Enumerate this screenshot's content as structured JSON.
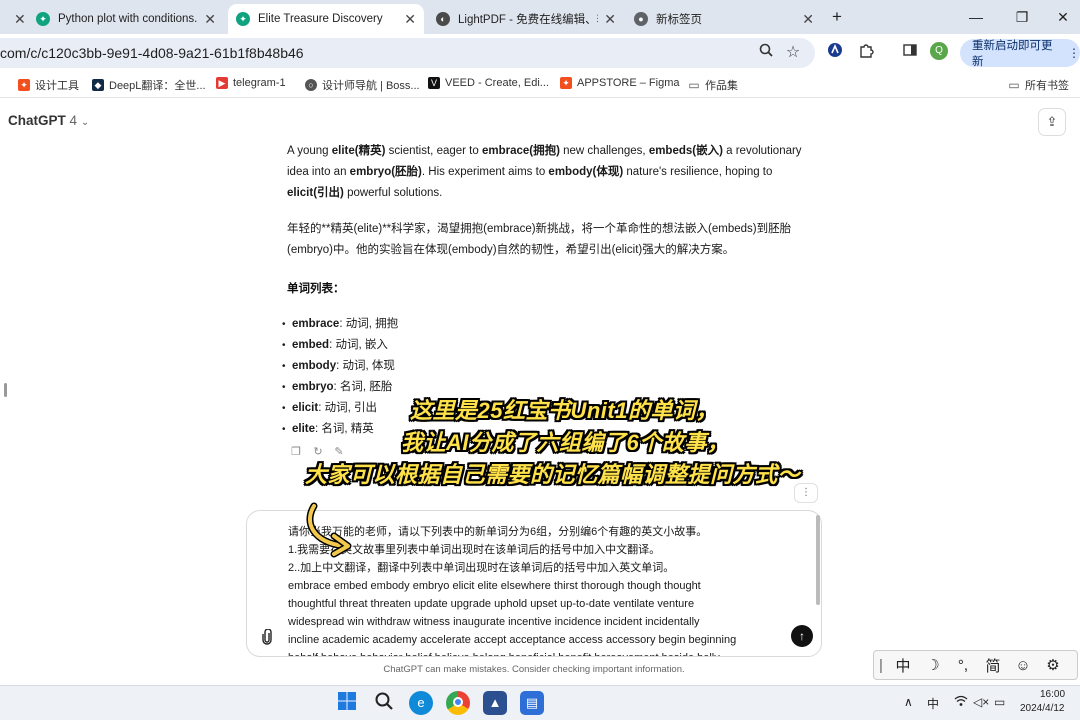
{
  "tabs": [
    {
      "title": "",
      "close": "✕"
    },
    {
      "title": "Python plot with conditions.",
      "close": "✕",
      "favicon_color": "#10a37f"
    },
    {
      "title": "Elite Treasure Discovery",
      "close": "✕",
      "favicon_color": "#10a37f",
      "active": true
    },
    {
      "title": "LightPDF - 免费在线编辑、转换",
      "close": "✕",
      "favicon_color": "#4a4a4a"
    },
    {
      "title": "新标签页",
      "close": "✕",
      "favicon_color": "#5f6368"
    }
  ],
  "new_tab": "+",
  "window_controls": {
    "minimize": "—",
    "maximize": "❐",
    "close": "✕"
  },
  "address": {
    "url": "com/c/c120c3bb-9e91-4d08-9a21-61b1f8b48b46",
    "update_button": "重新启动即可更新",
    "profile_initial": "Q"
  },
  "bookmarks": [
    {
      "label": "设计工具",
      "icon": "figma-icon",
      "color": "#f24e1e"
    },
    {
      "label": "DeepL翻译：全世...",
      "icon": "deepl-icon",
      "color": "#0f2b46"
    },
    {
      "label": "telegram-1",
      "icon": "telegram-icon",
      "color": "#e53935"
    },
    {
      "label": "设计师导航 | Boss...",
      "icon": "globe-icon",
      "color": "#555"
    },
    {
      "label": "VEED - Create, Edi...",
      "icon": "veed-icon",
      "color": "#111"
    },
    {
      "label": "APPSTORE – Figma",
      "icon": "figma-icon",
      "color": "#f24e1e"
    },
    {
      "label": "作品集",
      "icon": "folder-icon",
      "color": "#555"
    },
    {
      "label": "所有书签",
      "icon": "folder-icon",
      "color": "#555"
    }
  ],
  "chat": {
    "model_name": "ChatGPT",
    "model_version": "4",
    "story_en": {
      "s1": "A young ",
      "w1": "elite(精英)",
      "s2": " scientist, eager to ",
      "w2": "embrace(拥抱)",
      "s3": " new challenges, ",
      "w3": "embeds(嵌入)",
      "s4": " a revolutionary idea into an ",
      "w4": "embryo(胚胎)",
      "s5": ". His experiment aims to ",
      "w5": "embody(体现)",
      "s6": " nature's resilience, hoping to ",
      "w6": "elicit(引出)",
      "s7": " powerful solutions."
    },
    "story_zh": "年轻的**精英(elite)**科学家，渴望拥抱(embrace)新挑战，将一个革命性的想法嵌入(embeds)到胚胎(embryo)中。他的实验旨在体现(embody)自然的韧性，希望引出(elicit)强大的解决方案。",
    "vocab_heading": "单词列表：",
    "vocab": [
      {
        "word": "embrace",
        "def": ": 动词, 拥抱"
      },
      {
        "word": "embed",
        "def": ": 动词, 嵌入"
      },
      {
        "word": "embody",
        "def": ": 动词, 体现"
      },
      {
        "word": "embryo",
        "def": ": 名词, 胚胎"
      },
      {
        "word": "elicit",
        "def": ": 动词, 引出"
      },
      {
        "word": "elite",
        "def": ": 名词, 精英"
      }
    ]
  },
  "captions": [
    "这里是25红宝书Unit1的单词，",
    "我让AI分成了六组编了6个故事，",
    "大家可以根据自己需要的记忆篇幅调整提问方式～"
  ],
  "composer": {
    "lines": [
      "请你当我万能的老师，请以下列表中的新单词分为6组，分别编6个有趣的英文小故事。",
      "1.我需要在英文故事里列表中单词出现时在该单词后的括号中加入中文翻译。",
      "2..加上中文翻译，翻译中列表中单词出现时在该单词后的括号中加入英文单词。",
      "embrace embed embody embryo elicit elite elsewhere thirst thorough though thought",
      "thoughtful threat threaten update upgrade uphold upset up-to-date ventilate venture",
      "widespread win  withdraw witness inaugurate incentive incidence incident incidentally",
      "incline academic academy accelerate accept acceptance access accessory begin beginning",
      "behalf behave behavior belief believe belong beneficial benefit bereavement beside belly"
    ]
  },
  "disclaimer": "ChatGPT can make mistakes. Consider checking important information.",
  "ime": [
    "中",
    "☽",
    "°,",
    "简",
    "☺",
    "⚙"
  ],
  "tray": {
    "lang": "中",
    "time": "16:00",
    "date": "2024/4/12"
  }
}
